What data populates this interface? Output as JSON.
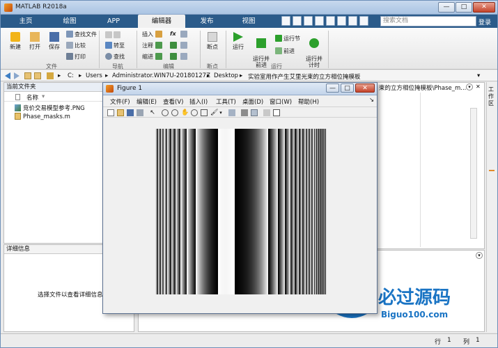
{
  "window": {
    "title": "MATLAB R2018a",
    "min": "—",
    "max": "□",
    "close": "✕"
  },
  "tabs": [
    {
      "label": "主页"
    },
    {
      "label": "绘图"
    },
    {
      "label": "APP"
    },
    {
      "label": "编辑器"
    },
    {
      "label": "发布"
    },
    {
      "label": "视图"
    }
  ],
  "search": {
    "placeholder": "搜索文档"
  },
  "login_label": "登录",
  "ribbon": {
    "file_group": {
      "label": "文件",
      "new": "新建",
      "open": "打开",
      "save": "保存",
      "find_files": "查找文件",
      "compare": "比较",
      "print": "打印"
    },
    "nav_group": {
      "label": "导航",
      "goto": "转至",
      "find": "查找"
    },
    "edit_group": {
      "label": "编辑",
      "insert": "插入",
      "comment": "注释",
      "indent": "缩进",
      "fx": "fx"
    },
    "breakpoints_group": {
      "label": "断点",
      "breakpoints": "断点"
    },
    "run_group": {
      "label": "运行",
      "run": "运行",
      "run_advance": "运行并\n前进",
      "run_section": "运行节",
      "advance": "前进",
      "run_time": "运行并\n计时"
    }
  },
  "address": {
    "crumbs": [
      "C:",
      "Users",
      "Administrator.WIN7U-20180127Z",
      "Desktop",
      "实验室用作产生艾里光束的立方相位掩模板"
    ],
    "editor_path": "束的立方相位掩模板\\Phase_m..."
  },
  "current_folder": {
    "title": "当前文件夹",
    "col_name": "名称",
    "files": [
      {
        "name": "竞价交易模型参考.PNG"
      },
      {
        "name": "Phase_masks.m"
      }
    ]
  },
  "details": {
    "title": "详细信息",
    "hint": "选择文件以查看详细信息"
  },
  "side_strip": {
    "label": "工作区"
  },
  "status": {
    "row_label": "行",
    "row": "1",
    "col_label": "列",
    "col": "1"
  },
  "figure": {
    "title": "Figure 1",
    "menu": [
      "文件(F)",
      "编辑(E)",
      "查看(V)",
      "插入(I)",
      "工具(T)",
      "桌面(D)",
      "窗口(W)",
      "帮助(H)"
    ]
  },
  "image_data": {
    "stripe_profile": "cubic-phase-mask-binary-grating"
  },
  "watermark": {
    "title": "必过源码",
    "url": "Biguo100.com"
  },
  "colors": {
    "tabstrip": "#2b5b8a",
    "accent": "#1a74c4"
  }
}
